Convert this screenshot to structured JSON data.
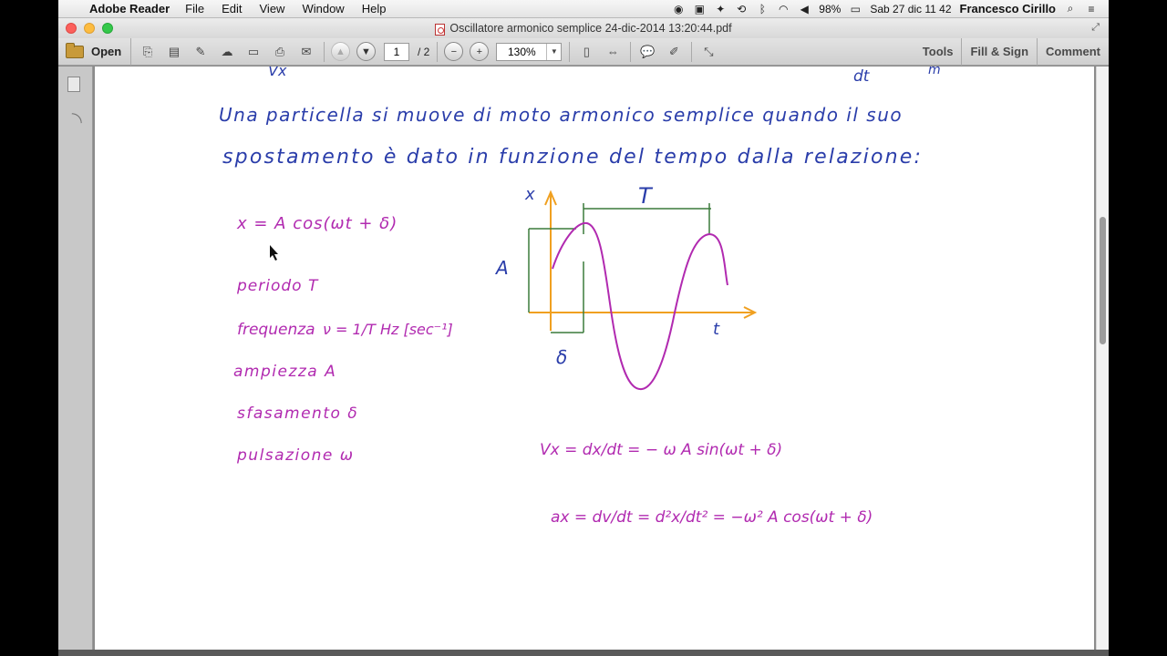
{
  "menubar": {
    "app_name": "Adobe Reader",
    "menus": [
      "File",
      "Edit",
      "View",
      "Window",
      "Help"
    ],
    "battery": "98%",
    "clock": "Sab 27 dic  11 42",
    "user": "Francesco Cirillo"
  },
  "window": {
    "title": "Oscillatore armonico semplice 24-dic-2014 13:20:44.pdf"
  },
  "toolbar": {
    "open_label": "Open",
    "page_current": "1",
    "page_total": "/ 2",
    "zoom": "130%",
    "tools_label": "Tools",
    "fill_sign_label": "Fill & Sign",
    "comment_label": "Comment"
  },
  "notes": {
    "top_fragment_left": "Vx",
    "top_fragment_mid": "dt",
    "top_fragment_right": "m",
    "line1": "Una particella si muove di moto armonico semplice quando il suo",
    "line2": "spostamento è dato in funzione del tempo dalla relazione:",
    "equation": "x = A cos(ωt + δ)",
    "periodo": "periodo  T",
    "frequenza_label": "frequenza",
    "frequenza_formula": "ν = 1/T  Hz [sec⁻¹]",
    "ampiezza": "ampiezza  A",
    "sfasamento": "sfasamento  δ",
    "pulsazione": "pulsazione  ω",
    "velocity": "Vx = dx/dt = − ω A sin(ωt + δ)",
    "acceleration": "ax = dv/dt = d²x/dt² = −ω² A cos(ωt + δ)",
    "graph_x_label": "x",
    "graph_t_label": "t",
    "graph_T_label": "T",
    "graph_A_label": "A",
    "graph_delta_label": "δ"
  },
  "colors": {
    "blue_ink": "#2a3daa",
    "purple_ink": "#b12ab0",
    "orange_axes": "#f0a020",
    "green_marks": "#3a7a3a"
  }
}
